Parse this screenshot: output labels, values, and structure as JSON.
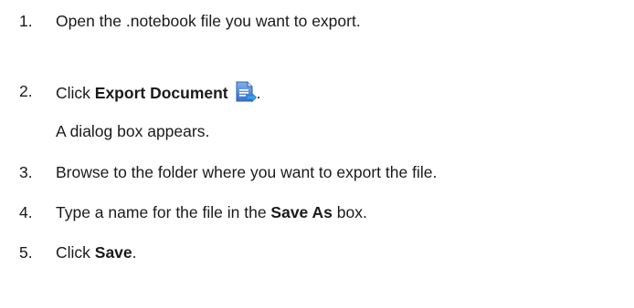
{
  "steps": [
    {
      "number": "1.",
      "text": "Open the .notebook file you want to export."
    },
    {
      "number": "2.",
      "prefix": "Click ",
      "bold": "Export Document",
      "icon": "export-document-icon",
      "suffix": ".",
      "note": "A dialog box appears."
    },
    {
      "number": "3.",
      "text": "Browse to the folder where you want to export the file."
    },
    {
      "number": "4.",
      "prefix": "Type a name for the file in the ",
      "bold": "Save As",
      "suffix": " box."
    },
    {
      "number": "5.",
      "prefix": "Click ",
      "bold": "Save",
      "suffix": "."
    }
  ],
  "colors": {
    "text": "#1a1a1a",
    "icon_page": "#4a7fd4",
    "icon_arrow": "#3aa0e8"
  }
}
